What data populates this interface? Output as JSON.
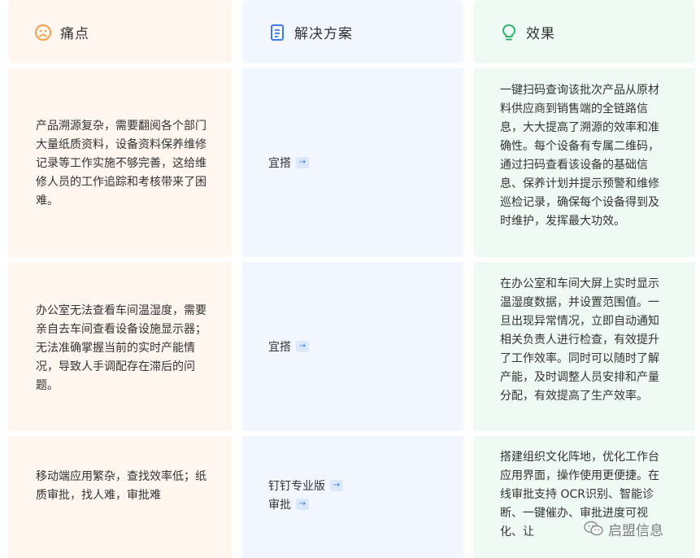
{
  "headers": {
    "pain": {
      "label": "痛点",
      "icon": "sad-face-icon",
      "color": "#f5a04a"
    },
    "solution": {
      "label": "解决方案",
      "icon": "document-icon",
      "color": "#3f7ce8"
    },
    "effect": {
      "label": "效果",
      "icon": "lightbulb-icon",
      "color": "#2fb36b"
    }
  },
  "rows": [
    {
      "pain": "产品溯源复杂，需要翻阅各个部门大量纸质资料，设备资料保养维修记录等工作实施不够完善，这给维修人员的工作追踪和考核带来了困难。",
      "solutions": [
        "宜搭"
      ],
      "effect": "一键扫码查询该批次产品从原材料供应商到销售端的全链路信息，大大提高了溯源的效率和准确性。每个设备有专属二维码，通过扫码查看该设备的基础信息、保养计划并提示预警和维修巡检记录，确保每个设备得到及时维护，发挥最大功效。"
    },
    {
      "pain": "办公室无法查看车间温湿度，需要亲自去车间查看设备设施显示器；无法准确掌握当前的实时产能情况，导致人手调配存在滞后的问题。",
      "solutions": [
        "宜搭"
      ],
      "effect": "在办公室和车间大屏上实时显示温湿度数据，并设置范围值。一旦出现异常情况，立即自动通知相关负责人进行检查，有效提升了工作效率。同时可以随时了解产能，及时调整人员安排和产量分配，有效提高了生产效率。"
    },
    {
      "pain": "移动端应用繁杂，查找效率低；纸质审批，找人难，审批难",
      "solutions": [
        "钉钉专业版",
        "审批"
      ],
      "effect": "搭建组织文化阵地，优化工作台应用界面，操作使用更便捷。在线审批支持 OCR识别、智能诊断、一键催办、审批进度可视化、让"
    }
  ],
  "arrow_glyph": "→",
  "watermark": {
    "text": "启盟信息",
    "icon": "wechat-icon"
  }
}
